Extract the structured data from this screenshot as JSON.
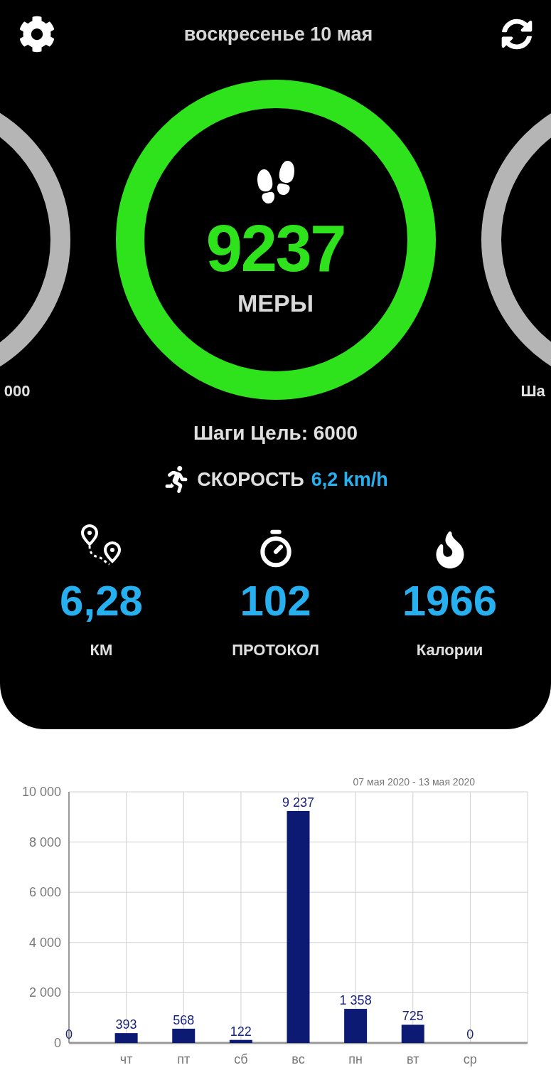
{
  "header": {
    "date": "воскресенье 10 мая"
  },
  "rings": [
    {
      "kind": "side",
      "label": "000"
    },
    {
      "kind": "main",
      "value": "9237",
      "unit": "МЕРЫ"
    },
    {
      "kind": "side",
      "label": "Ша"
    }
  ],
  "goal": "Шаги Цель: **6000**",
  "speed": {
    "label": "СКОРОСТЬ",
    "value": "6,2 km/h"
  },
  "stats": [
    {
      "kind": "distance",
      "value": "6,28",
      "label": "КМ"
    },
    {
      "kind": "time",
      "value": "102",
      "label": "ПРОТОКОЛ"
    },
    {
      "kind": "calories",
      "value": "1966",
      "label": "Калории"
    }
  ],
  "chart": {
    "chart_data": {
      "type": "bar",
      "title": "07 мая 2020 - 13 мая 2020",
      "categories": [
        null,
        "чт",
        "пт",
        "сб",
        "вс",
        "пн",
        "вт",
        "ср"
      ],
      "grid": true,
      "series": [
        {
          "color": "#0d1a73",
          "values": [
            0,
            393,
            568,
            122,
            9237,
            1358,
            725,
            0
          ]
        }
      ],
      "ylim": [
        0,
        10000
      ],
      "yticks": [
        {
          "value": 0,
          "label": "0"
        },
        {
          "value": 2000,
          "label": "2 000"
        },
        {
          "value": 4000,
          "label": "4 000"
        },
        {
          "value": 6000,
          "label": "6 000"
        },
        {
          "value": 8000,
          "label": "8 000"
        },
        {
          "value": 10000,
          "label": "10 000"
        }
      ],
      "data_labels": true,
      "value_labels": [
        "0",
        "393",
        "568",
        "122",
        "9 237",
        "1 358",
        "725",
        "0"
      ]
    }
  }
}
